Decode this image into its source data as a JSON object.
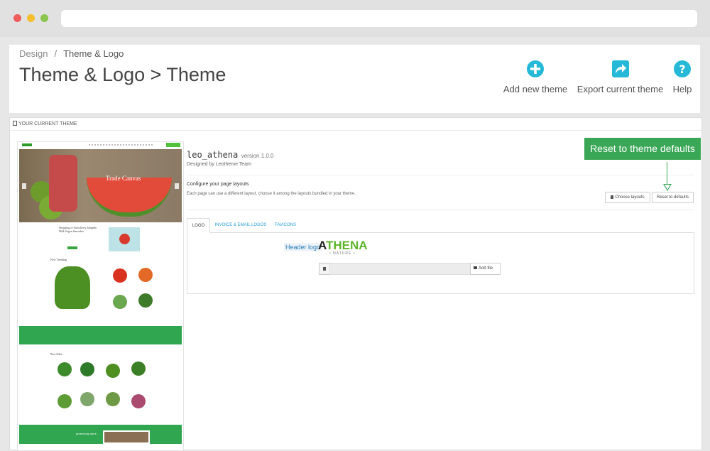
{
  "breadcrumb": {
    "parent": "Design",
    "separator": "/",
    "current": "Theme & Logo"
  },
  "page_title": "Theme & Logo > Theme",
  "toolbar": {
    "add_new_theme": "Add new theme",
    "export_current_theme": "Export current theme",
    "help": "Help",
    "accent_color": "#25b9d7"
  },
  "panel": {
    "heading": "YOUR CURRENT THEME"
  },
  "preview": {
    "hero_text": "Trade Canvas",
    "promo_text": "Shopping of Strawberry Jalapeño Milk Vegan Smoothie",
    "new_trending": "New Trending",
    "best_seller": "Best Seller",
    "band_text": "greenshop store"
  },
  "theme": {
    "name": "leo_athena",
    "version": "version 1.0.0",
    "designer": "Designed by Leotheme Team"
  },
  "layouts": {
    "title": "Configure your page layouts",
    "description": "Each page can use a different layout, choose it among the layouts bundled in your theme.",
    "choose_button": "Choose layouts",
    "reset_button": "Reset to defaults"
  },
  "callout": {
    "text": "Reset to theme defaults",
    "color": "#3aa757"
  },
  "tabs": [
    {
      "label": "LOGO",
      "active": true
    },
    {
      "label": "INVOICE & EMAIL LOGOS",
      "active": false
    },
    {
      "label": "FAVICONS",
      "active": false
    }
  ],
  "logo": {
    "header_logo_label": "Header logo",
    "brand_first_letter": "A",
    "brand_rest": "THENA",
    "brand_sub": "• NATURE •",
    "add_file": "Add file"
  }
}
